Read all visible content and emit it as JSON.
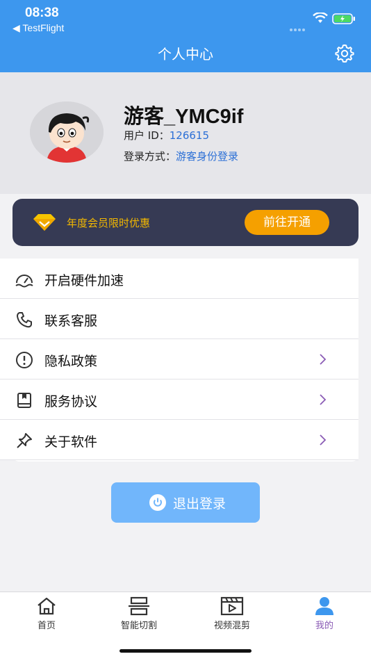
{
  "status_bar": {
    "time": "08:38",
    "back_app": "◀ TestFlight"
  },
  "header": {
    "title": "个人中心",
    "settings_icon": "gear-icon"
  },
  "profile": {
    "name": "游客_YMC9if",
    "user_id_label": "用户 ID：",
    "user_id": "126615",
    "login_label": "登录方式：",
    "login_method": "游客身份登录"
  },
  "vip_banner": {
    "text": "年度会员限时优惠",
    "button": "前往开通",
    "icon": "diamond-icon"
  },
  "menu": [
    {
      "label": "开启硬件加速",
      "icon": "speedometer-icon"
    },
    {
      "label": "联系客服",
      "icon": "phone-icon"
    },
    {
      "label": "隐私政策",
      "icon": "alert-circle-icon"
    },
    {
      "label": "服务协议",
      "icon": "book-icon"
    },
    {
      "label": "关于软件",
      "icon": "pin-icon"
    }
  ],
  "logout": {
    "label": "退出登录",
    "icon": "power-icon"
  },
  "tabs": [
    {
      "label": "首页",
      "icon": "home-icon"
    },
    {
      "label": "智能切割",
      "icon": "split-icon"
    },
    {
      "label": "视频混剪",
      "icon": "clapperboard-icon"
    },
    {
      "label": "我的",
      "icon": "person-icon",
      "active": true
    }
  ],
  "colors": {
    "accent": "#3d97ee",
    "vip_bg": "#363a54",
    "vip_gold": "#f5a000",
    "active_tab": "#8a5bb5"
  }
}
